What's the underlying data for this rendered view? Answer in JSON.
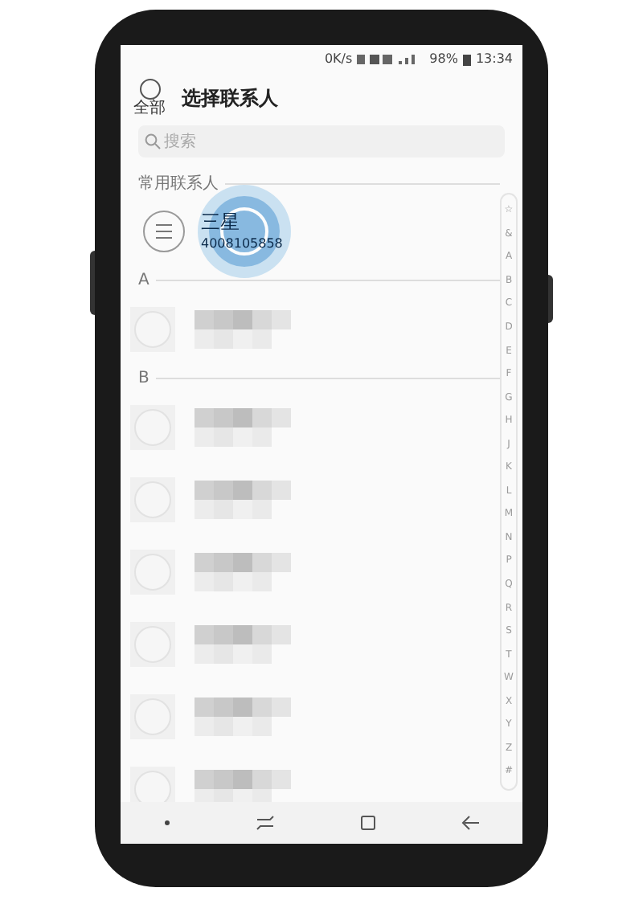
{
  "status_bar": {
    "speed": "0K/s",
    "battery": "98%",
    "time": "13:34"
  },
  "header": {
    "select_all_label": "全部",
    "title": "选择联系人"
  },
  "search": {
    "placeholder": "搜索"
  },
  "sections": [
    {
      "title": "常用联系人",
      "rows": [
        {
          "kind": "contact",
          "name": "三星",
          "number": "4008105858"
        }
      ]
    },
    {
      "title": "A",
      "rows": [
        {
          "kind": "obscured"
        }
      ]
    },
    {
      "title": "B",
      "rows": [
        {
          "kind": "obscured"
        },
        {
          "kind": "obscured"
        },
        {
          "kind": "obscured"
        },
        {
          "kind": "obscured"
        },
        {
          "kind": "obscured"
        },
        {
          "kind": "obscured"
        }
      ]
    }
  ],
  "index": [
    "☆",
    "&",
    "A",
    "B",
    "C",
    "D",
    "E",
    "F",
    "G",
    "H",
    "J",
    "K",
    "L",
    "M",
    "N",
    "P",
    "Q",
    "R",
    "S",
    "T",
    "W",
    "X",
    "Y",
    "Z",
    "#"
  ]
}
